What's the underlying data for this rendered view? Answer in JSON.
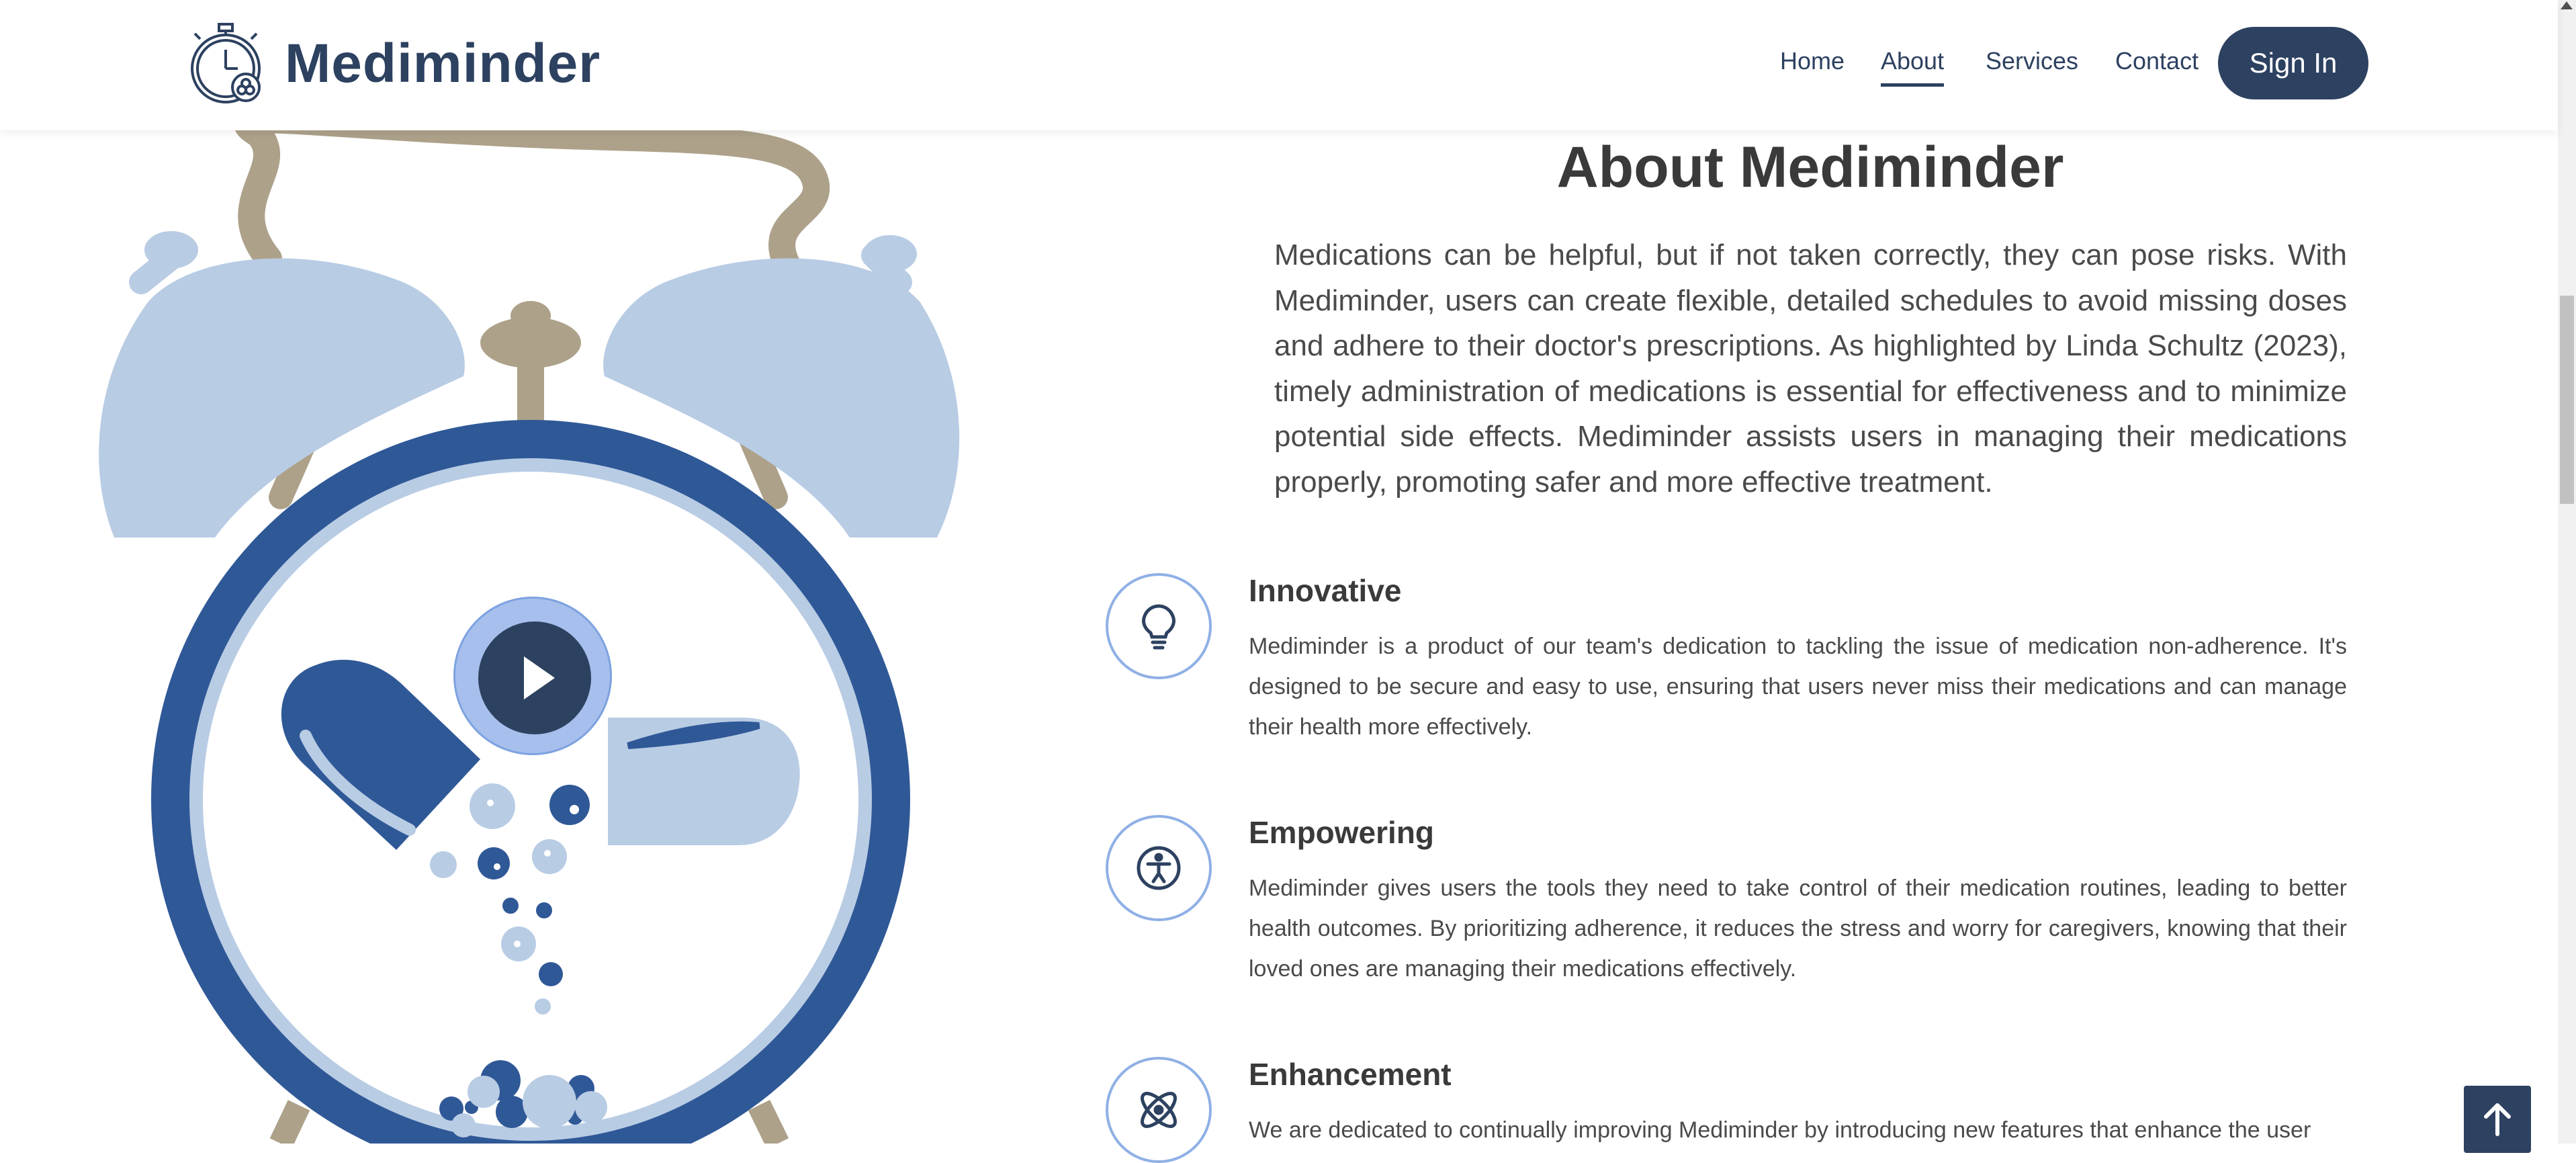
{
  "header": {
    "brand": "Mediminder",
    "nav": [
      "Home",
      "About",
      "Services",
      "Contact"
    ],
    "active_nav": "About",
    "signin_label": "Sign In"
  },
  "about": {
    "title": "About Mediminder",
    "intro": "Medications can be helpful, but if not taken correctly, they can pose risks. With Mediminder, users can create flexible, detailed schedules to avoid missing doses and adhere to their doctor's prescriptions. As highlighted by Linda Schultz (2023), timely administration of medications is essential for effectiveness and to minimize potential side effects. Mediminder assists users in managing their medications properly, promoting safer and more effective treatment."
  },
  "features": [
    {
      "icon": "lightbulb-icon",
      "title": "Innovative",
      "text": "Mediminder is a product of our team's dedication to tackling the issue of medication non-adherence. It's designed to be secure and easy to use, ensuring that users never miss their medications and can manage their health more effectively."
    },
    {
      "icon": "accessibility-icon",
      "title": "Empowering",
      "text": "Mediminder gives users the tools they need to take control of their medication routines, leading to better health outcomes. By prioritizing adherence, it reduces the stress and worry for caregivers, knowing that their loved ones are managing their medications effectively."
    },
    {
      "icon": "atom-icon",
      "title": "Enhancement",
      "text": "We are dedicated to continually improving Mediminder by introducing new features that enhance the user"
    }
  ],
  "colors": {
    "brand": "#2d4160",
    "accent": "#2f5897",
    "light_blue": "#b8cce4",
    "bell_tan": "#ada18a",
    "play_ring": "#a7bfec"
  },
  "icons": [
    "stopwatch-pill-logo-icon",
    "play-icon",
    "arrow-up-icon"
  ]
}
